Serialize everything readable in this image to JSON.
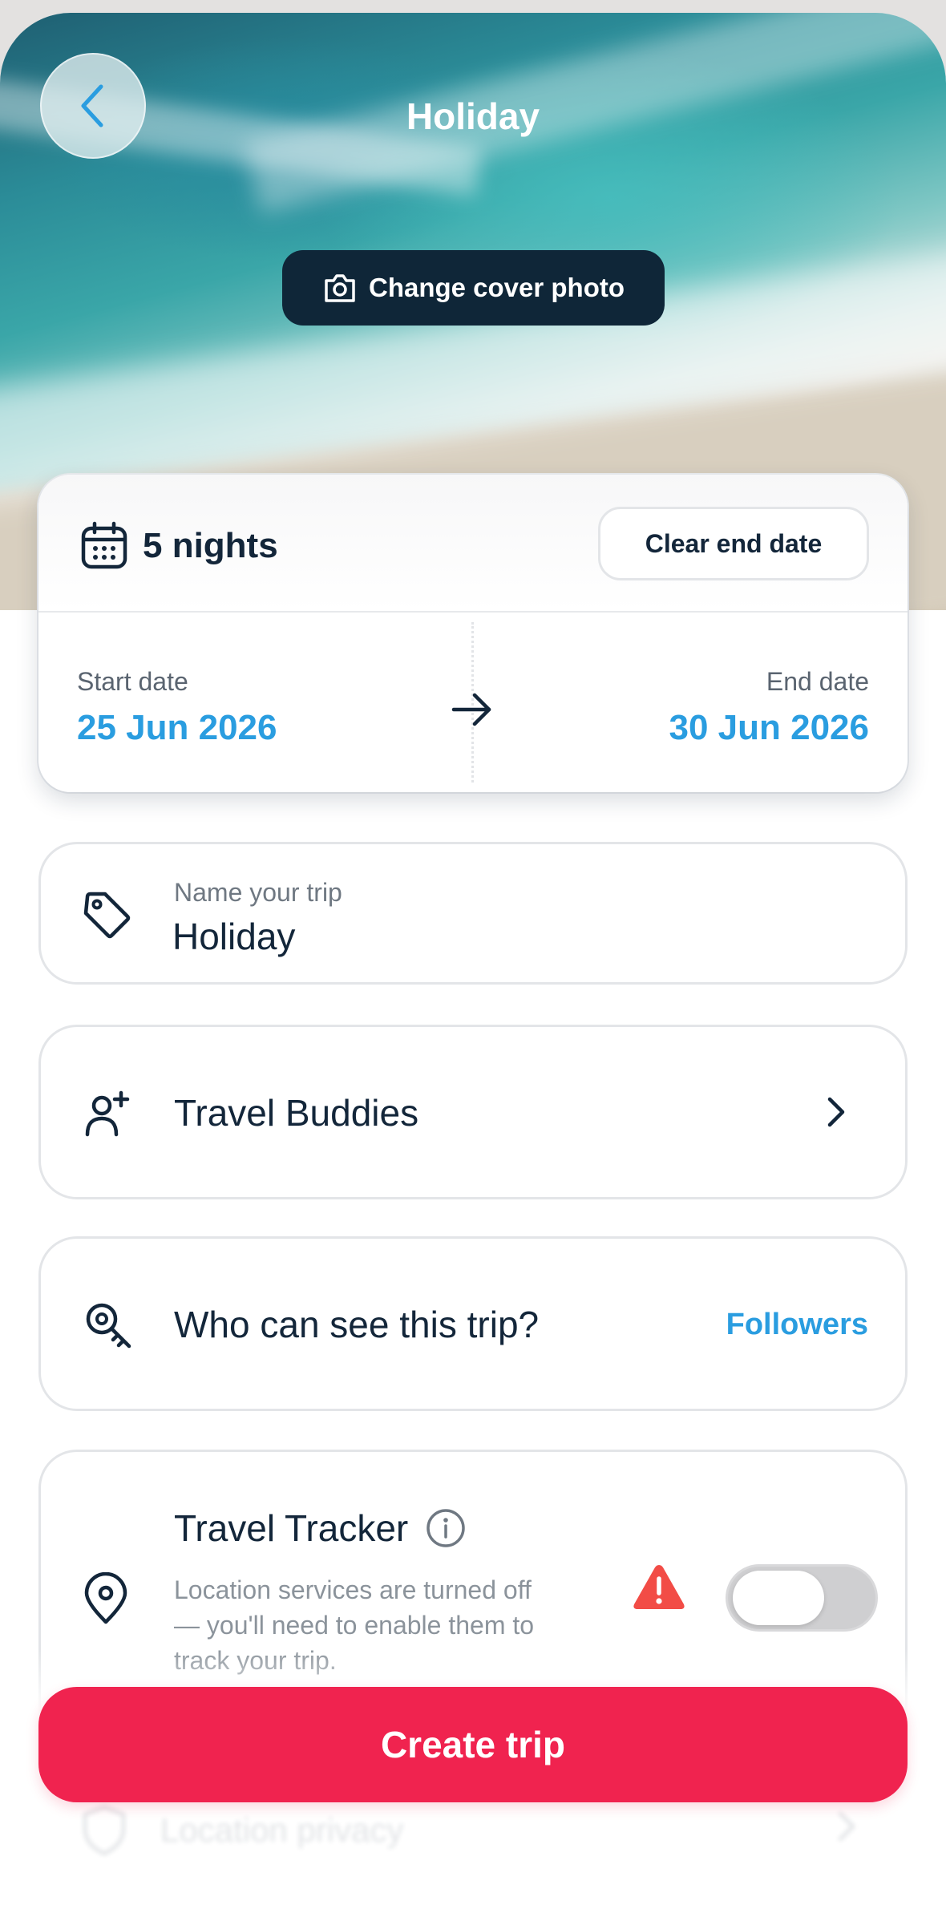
{
  "header": {
    "title": "Holiday"
  },
  "cover": {
    "change_photo_label": "Change cover photo"
  },
  "dates": {
    "nights_label": "5 nights",
    "clear_end_date_label": "Clear end date",
    "start_label": "Start date",
    "start_value": "25 Jun 2026",
    "end_label": "End date",
    "end_value": "30 Jun 2026"
  },
  "trip_name": {
    "label": "Name your trip",
    "value": "Holiday"
  },
  "travel_buddies": {
    "label": "Travel Buddies"
  },
  "visibility": {
    "question": "Who can see this trip?",
    "value": "Followers"
  },
  "tracker": {
    "title": "Travel Tracker",
    "description": "Location services are turned off — you'll need to enable them to track your trip.",
    "enabled": false
  },
  "location_privacy": {
    "label": "Location privacy"
  },
  "actions": {
    "create_label": "Create trip"
  },
  "colors": {
    "accent_blue": "#2a9de0",
    "primary_red": "#f0234f",
    "dark_navy": "#0f2638",
    "warning_red": "#f24c46"
  },
  "icons": [
    "chevron-left-icon",
    "camera-icon",
    "calendar-icon",
    "arrow-right-icon",
    "tag-icon",
    "add-person-icon",
    "chevron-right-icon",
    "key-search-icon",
    "location-pin-icon",
    "info-icon",
    "warning-icon"
  ]
}
